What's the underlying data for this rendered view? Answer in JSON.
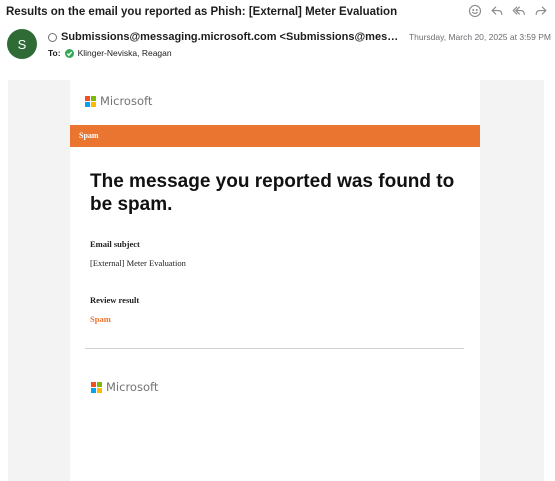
{
  "email": {
    "subject": "Results on the email you reported as Phish: [External] Meter Evaluation",
    "avatar_initial": "S",
    "from": "Submissions@messaging.microsoft.com <Submissions@messaging.micr...",
    "date": "Thursday, March 20, 2025 at 3:59 PM",
    "to_label": "To:",
    "to_name": "Klinger-Neviska, Reagan",
    "toolbar_icons": [
      "smiley-icon",
      "reply-icon",
      "reply-all-icon",
      "forward-icon"
    ]
  },
  "body": {
    "logo_text": "Microsoft",
    "banner": "Spam",
    "headline": "The message you reported was found to be spam.",
    "subject_label": "Email subject",
    "subject_value": "[External] Meter Evaluation",
    "result_label": "Review result",
    "result_value": "Spam",
    "footer_logo_text": "Microsoft"
  },
  "colors": {
    "avatar": "#2f6b34",
    "banner": "#ea7530",
    "ms_red": "#f25022",
    "ms_green": "#7fba00",
    "ms_blue": "#00a4ef",
    "ms_yellow": "#ffb900"
  }
}
